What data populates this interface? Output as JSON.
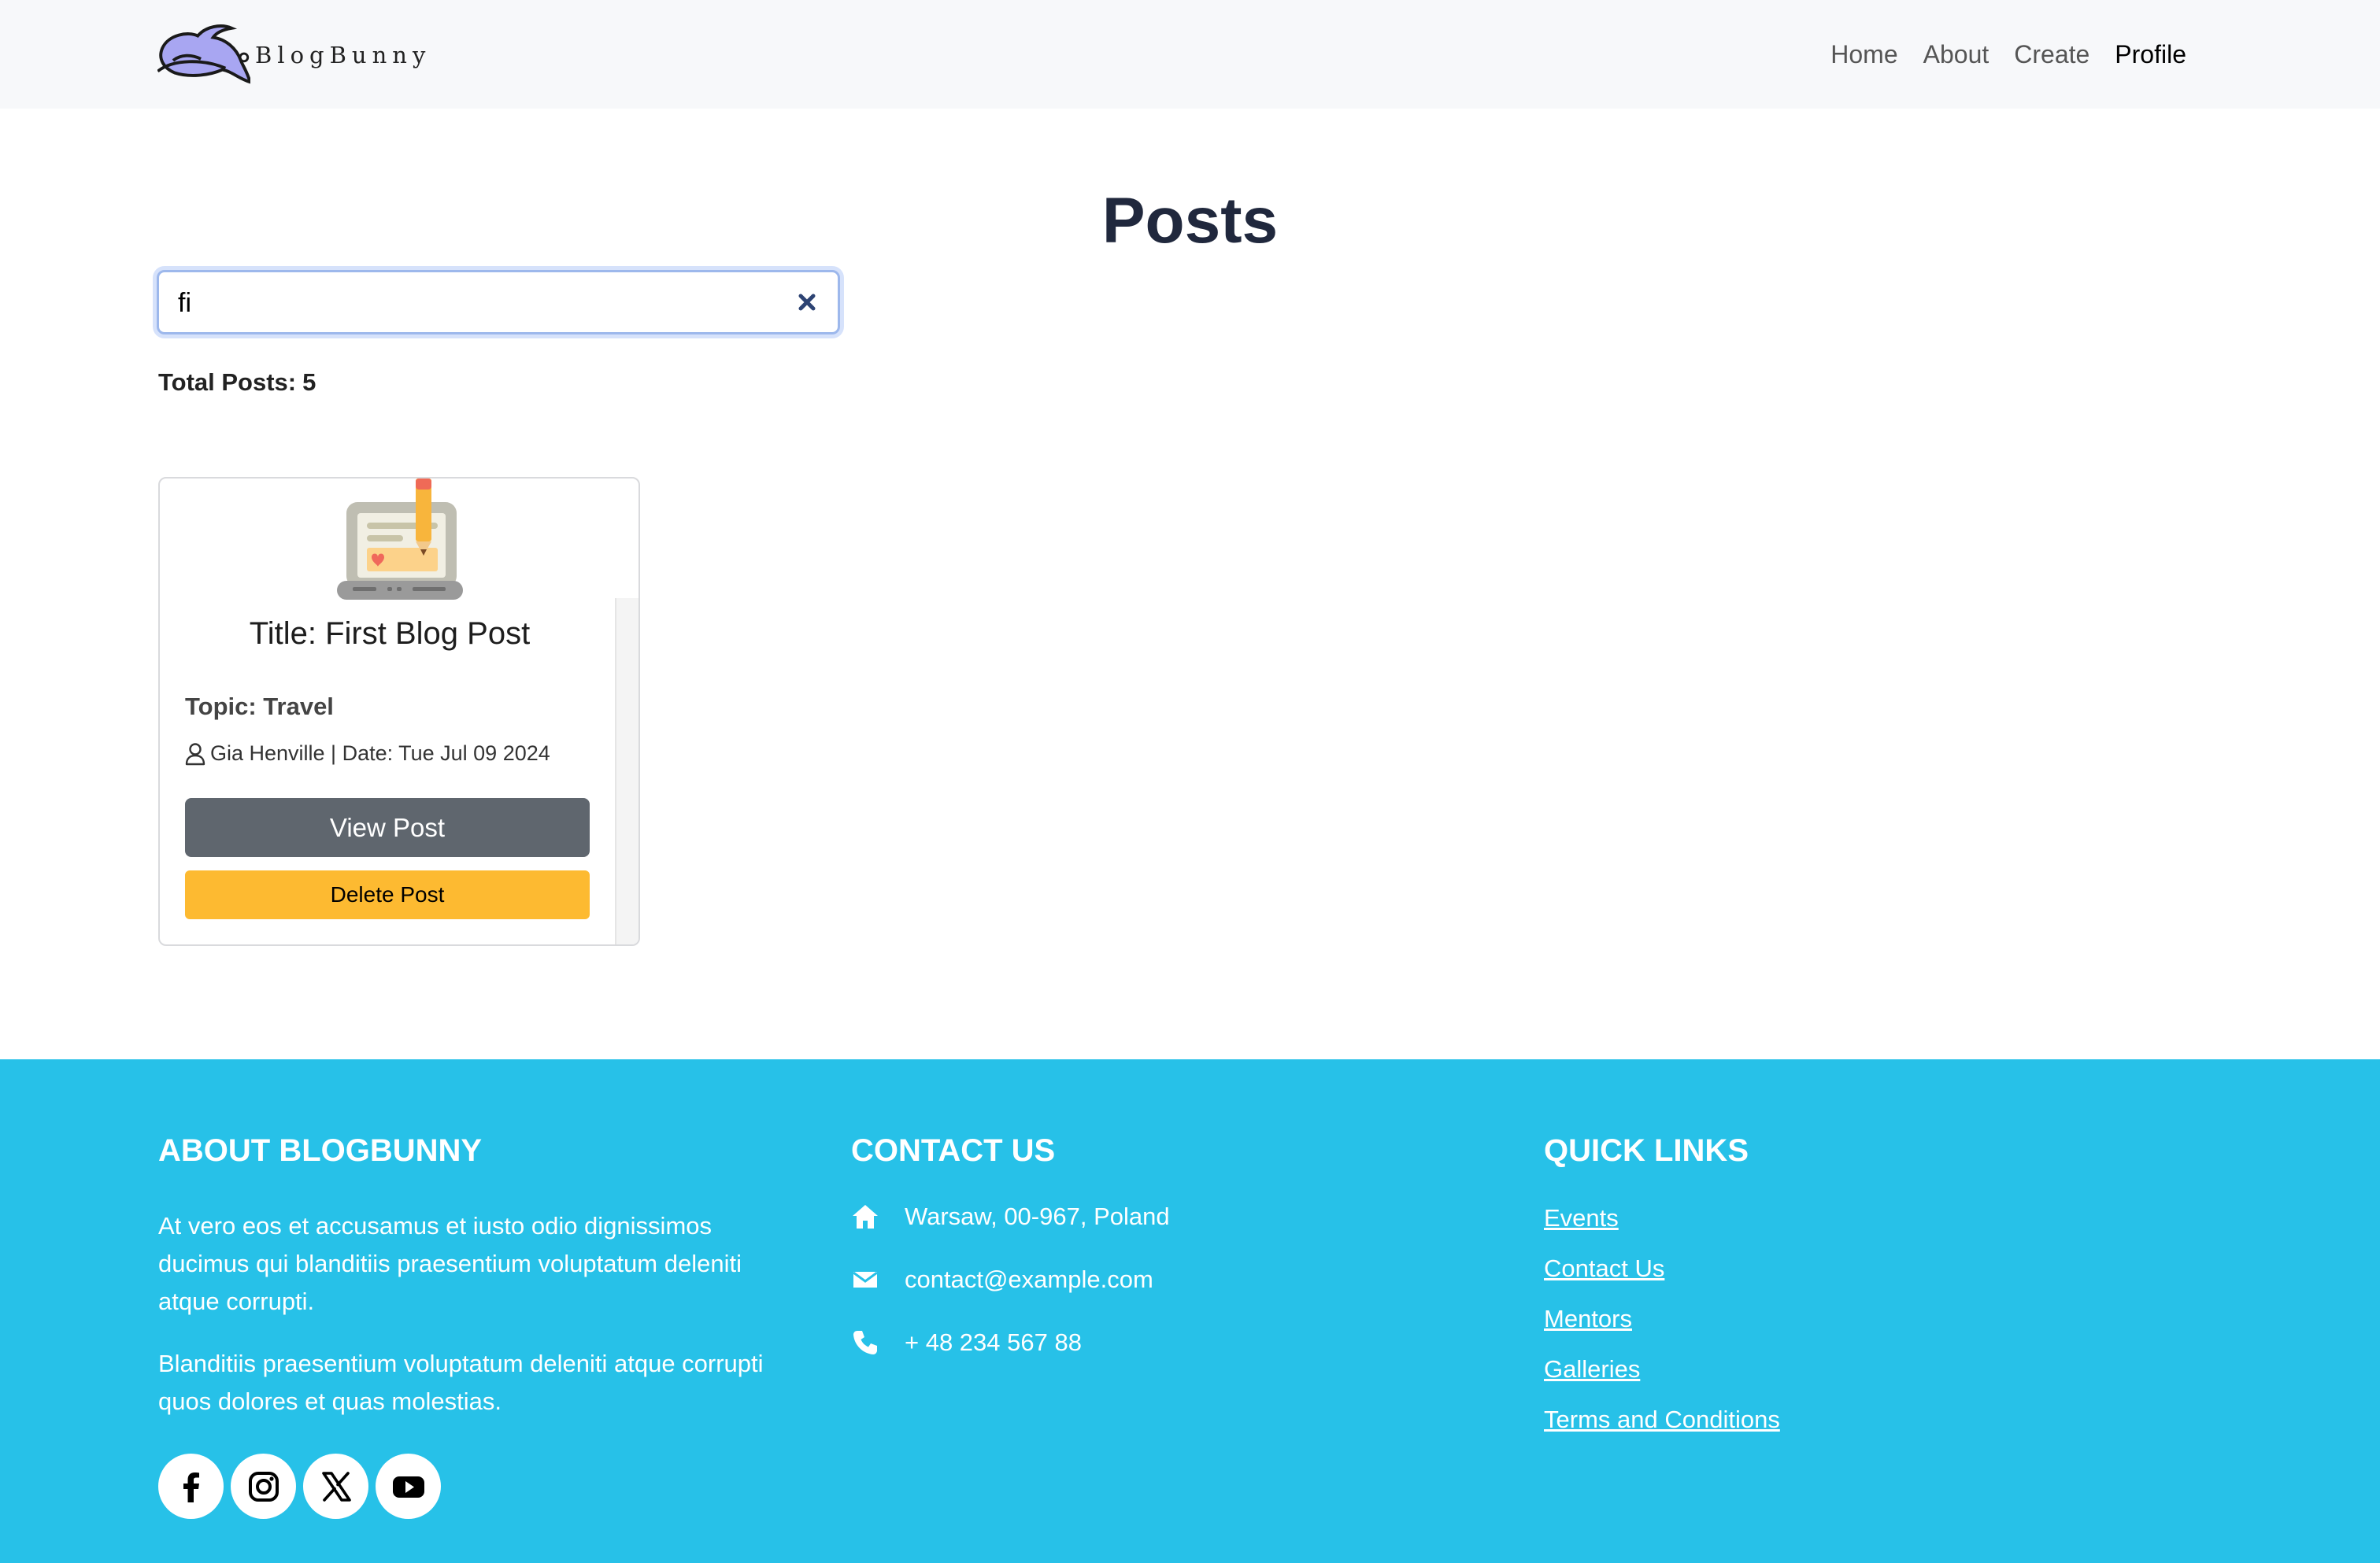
{
  "brand": {
    "name": "BlogBunny"
  },
  "nav": {
    "items": [
      "Home",
      "About",
      "Create",
      "Profile"
    ],
    "active": "Profile"
  },
  "main": {
    "title": "Posts",
    "search": {
      "value": "fi",
      "placeholder": ""
    },
    "total_label": "Total Posts:",
    "total_count": "5"
  },
  "post": {
    "title": "Title: First Blog Post",
    "topic": "Topic: Travel",
    "meta": "Gia Henville | Date: Tue Jul 09 2024",
    "view_label": "View Post",
    "delete_label": "Delete Post"
  },
  "footer": {
    "about": {
      "heading": "ABOUT BLOGBUNNY",
      "p1": "At vero eos et accusamus et iusto odio dignissimos ducimus qui blanditiis praesentium voluptatum deleniti atque corrupti.",
      "p2": "Blanditiis praesentium voluptatum deleniti atque corrupti quos dolores et quas molestias."
    },
    "contact": {
      "heading": "CONTACT US",
      "address": "Warsaw, 00-967, Poland",
      "email": "contact@example.com",
      "phone": "+ 48 234 567 88"
    },
    "links": {
      "heading": "QUICK LINKS",
      "items": [
        "Events",
        "Contact Us",
        "Mentors",
        "Galleries",
        "Terms and Conditions"
      ]
    },
    "socials": [
      "facebook-icon",
      "instagram-icon",
      "x-icon",
      "youtube-icon"
    ]
  },
  "colors": {
    "footer_bg": "#27c1e8",
    "delete_btn": "#fdba31",
    "view_btn": "#5f666e",
    "title": "#20283d"
  }
}
